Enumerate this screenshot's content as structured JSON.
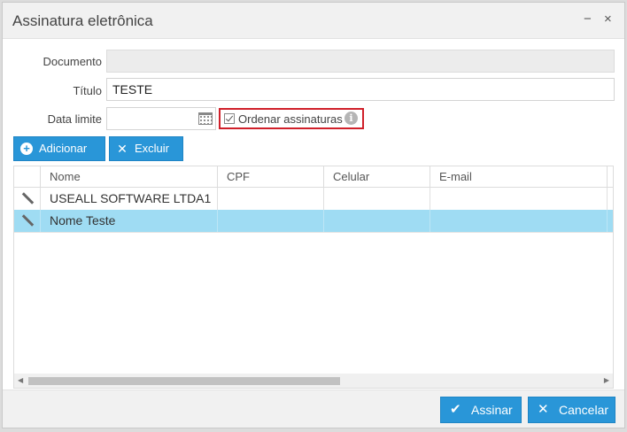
{
  "dialog": {
    "title": "Assinatura eletrônica",
    "minimize_icon": "−",
    "close_icon": "×"
  },
  "form": {
    "documento_label": "Documento",
    "documento_value": "",
    "titulo_label": "Título",
    "titulo_value": "TESTE",
    "data_limite_label": "Data limite",
    "data_limite_value": "",
    "ordenar_label": "Ordenar assinaturas",
    "ordenar_checked": true,
    "info_icon": "i"
  },
  "toolbar": {
    "add_label": "Adicionar",
    "add_icon": "+",
    "delete_label": "Excluir",
    "delete_icon": "✕"
  },
  "grid": {
    "columns": [
      "Nome",
      "CPF",
      "Celular",
      "E-mail"
    ],
    "rows": [
      {
        "nome": "USEALL SOFTWARE LTDA1",
        "cpf": "",
        "celular": "",
        "email": "",
        "selected": false
      },
      {
        "nome": "Nome Teste",
        "cpf": "",
        "celular": "",
        "email": "",
        "selected": true
      }
    ],
    "scroll_left_icon": "◀",
    "scroll_right_icon": "▶"
  },
  "footer": {
    "sign_label": "Assinar",
    "sign_icon": "✔",
    "cancel_label": "Cancelar",
    "cancel_icon": "✕"
  },
  "colors": {
    "accent": "#2996d8",
    "selected_row": "#9fdcf3",
    "highlight_box": "#d0202a"
  }
}
